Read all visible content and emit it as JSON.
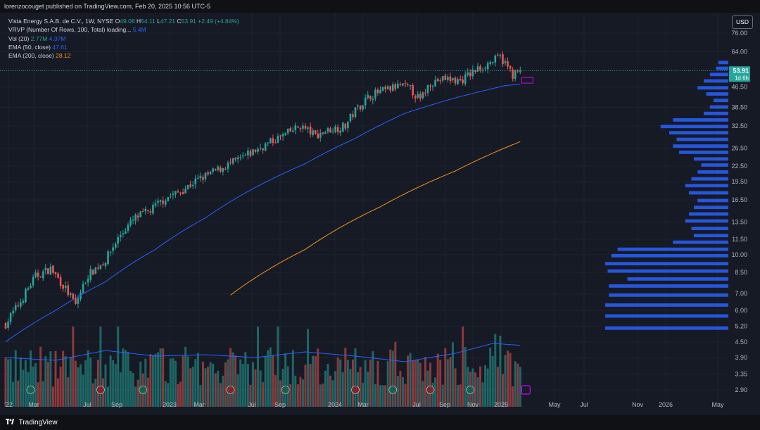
{
  "header": {
    "publisher_line": "lorenzocouget published on TradingView.com, Feb 20, 2025 10:56 UTC-5"
  },
  "footer": {
    "brand": "TradingView"
  },
  "currency_button": "USD",
  "legend": {
    "symbol": "Vista Energy S.A.B. de C.V., 1W, NYSE",
    "o_label": "O",
    "o": "49.08",
    "h_label": "H",
    "h": "54.11",
    "l_label": "L",
    "l": "47.21",
    "c_label": "C",
    "c": "53.91",
    "change": "+2.49 (+4.84%)",
    "vrvp_label": "VRVP (Number Of Rows, 100, Total) loading...",
    "vrvp_value": "5.4M",
    "vol_label": "Vol (20)",
    "vol_value": "2.77M",
    "vol_ma": "4.37M",
    "ema50_label": "EMA (50, close)",
    "ema50_value": "47.61",
    "ema200_label": "EMA (200, close)",
    "ema200_value": "28.12"
  },
  "price_tag": {
    "price": "53.91",
    "countdown": "1d 6h"
  },
  "colors": {
    "up": "#26a69a",
    "down": "#ef5350",
    "ema50": "#2962ff",
    "ema200": "#f7931a",
    "vrvp": "#2962ff",
    "earnings_marker": "#d500f9"
  },
  "chart_data": {
    "type": "candlestick",
    "title": "Vista Energy S.A.B. de C.V., 1W, NYSE",
    "y_scale": "log",
    "y_ticks": [
      76.0,
      64.0,
      53.91,
      46.5,
      38.5,
      32.5,
      26.5,
      22.5,
      19.5,
      16.5,
      13.5,
      11.5,
      10.0,
      8.5,
      7.0,
      6.0,
      5.2,
      4.5,
      3.9,
      3.35,
      2.9
    ],
    "x_ticks": [
      "'22",
      "Mar",
      "Jul",
      "Sep",
      "2023",
      "Mar",
      "Jul",
      "Sep",
      "2024",
      "Mar",
      "Jul",
      "Sep",
      "Nov",
      "2025",
      "May",
      "Jul",
      "Nov",
      "2026",
      "May"
    ],
    "price_anchors": [
      [
        0,
        5.3
      ],
      [
        6,
        6.5
      ],
      [
        12,
        8.2
      ],
      [
        18,
        8.8
      ],
      [
        24,
        7.3
      ],
      [
        28,
        6.3
      ],
      [
        33,
        8.3
      ],
      [
        40,
        9.5
      ],
      [
        46,
        12.0
      ],
      [
        52,
        14.0
      ],
      [
        58,
        15.0
      ],
      [
        64,
        16.8
      ],
      [
        70,
        17.8
      ],
      [
        76,
        19.6
      ],
      [
        82,
        21.0
      ],
      [
        88,
        22.5
      ],
      [
        94,
        24.0
      ],
      [
        100,
        26.0
      ],
      [
        106,
        28.0
      ],
      [
        112,
        30.0
      ],
      [
        118,
        32.5
      ],
      [
        124,
        29.8
      ],
      [
        130,
        31.5
      ],
      [
        136,
        32.5
      ],
      [
        140,
        37.5
      ],
      [
        146,
        43.0
      ],
      [
        152,
        45.0
      ],
      [
        158,
        47.0
      ],
      [
        162,
        45.5
      ],
      [
        166,
        41.0
      ],
      [
        170,
        48.5
      ],
      [
        176,
        50.0
      ],
      [
        182,
        49.0
      ],
      [
        188,
        54.0
      ],
      [
        193,
        57.5
      ],
      [
        198,
        61.0
      ],
      [
        203,
        52.0
      ],
      [
        206,
        53.91
      ]
    ],
    "ema50_anchors": [
      [
        0,
        4.5
      ],
      [
        20,
        6.0
      ],
      [
        40,
        7.8
      ],
      [
        60,
        10.5
      ],
      [
        80,
        14.0
      ],
      [
        100,
        18.5
      ],
      [
        120,
        23.0
      ],
      [
        140,
        29.0
      ],
      [
        160,
        36.5
      ],
      [
        180,
        42.0
      ],
      [
        200,
        47.0
      ],
      [
        206,
        47.61
      ]
    ],
    "ema200_anchors": [
      [
        90,
        6.9
      ],
      [
        120,
        10.5
      ],
      [
        150,
        15.5
      ],
      [
        180,
        21.5
      ],
      [
        206,
        28.12
      ]
    ],
    "volume_ma_anchors": [
      [
        0,
        3.5
      ],
      [
        20,
        3.3
      ],
      [
        40,
        4.0
      ],
      [
        60,
        3.6
      ],
      [
        80,
        3.7
      ],
      [
        100,
        3.5
      ],
      [
        120,
        3.9
      ],
      [
        140,
        3.6
      ],
      [
        160,
        3.2
      ],
      [
        180,
        3.8
      ],
      [
        195,
        4.5
      ],
      [
        206,
        4.37
      ]
    ],
    "earnings_weeks": [
      10,
      38,
      55,
      90,
      112,
      140,
      155,
      170,
      186
    ],
    "vrvp_profile": [
      [
        1.0,
        5.1
      ],
      [
        1.0,
        5.7
      ],
      [
        1.0,
        6.3
      ],
      [
        0.97,
        6.9
      ],
      [
        0.97,
        7.5
      ],
      [
        0.82,
        8.0
      ],
      [
        0.98,
        8.6
      ],
      [
        1.0,
        9.2
      ],
      [
        0.95,
        9.9
      ],
      [
        0.9,
        10.5
      ],
      [
        0.45,
        11.2
      ],
      [
        0.28,
        11.9
      ],
      [
        0.3,
        12.7
      ],
      [
        0.35,
        13.6
      ],
      [
        0.32,
        14.5
      ],
      [
        0.28,
        15.4
      ],
      [
        0.25,
        16.4
      ],
      [
        0.32,
        17.6
      ],
      [
        0.35,
        18.8
      ],
      [
        0.3,
        20.0
      ],
      [
        0.25,
        21.3
      ],
      [
        0.22,
        22.7
      ],
      [
        0.28,
        24.0
      ],
      [
        0.4,
        25.5
      ],
      [
        0.45,
        27.0
      ],
      [
        0.42,
        28.7
      ],
      [
        0.48,
        30.5
      ],
      [
        0.55,
        32.3
      ],
      [
        0.45,
        34.3
      ],
      [
        0.2,
        36.4
      ],
      [
        0.15,
        38.6
      ],
      [
        0.12,
        41.0
      ],
      [
        0.18,
        43.5
      ],
      [
        0.25,
        46.0
      ],
      [
        0.2,
        49.0
      ],
      [
        0.15,
        52.0
      ],
      [
        0.1,
        55.0
      ],
      [
        0.08,
        58.0
      ]
    ]
  }
}
